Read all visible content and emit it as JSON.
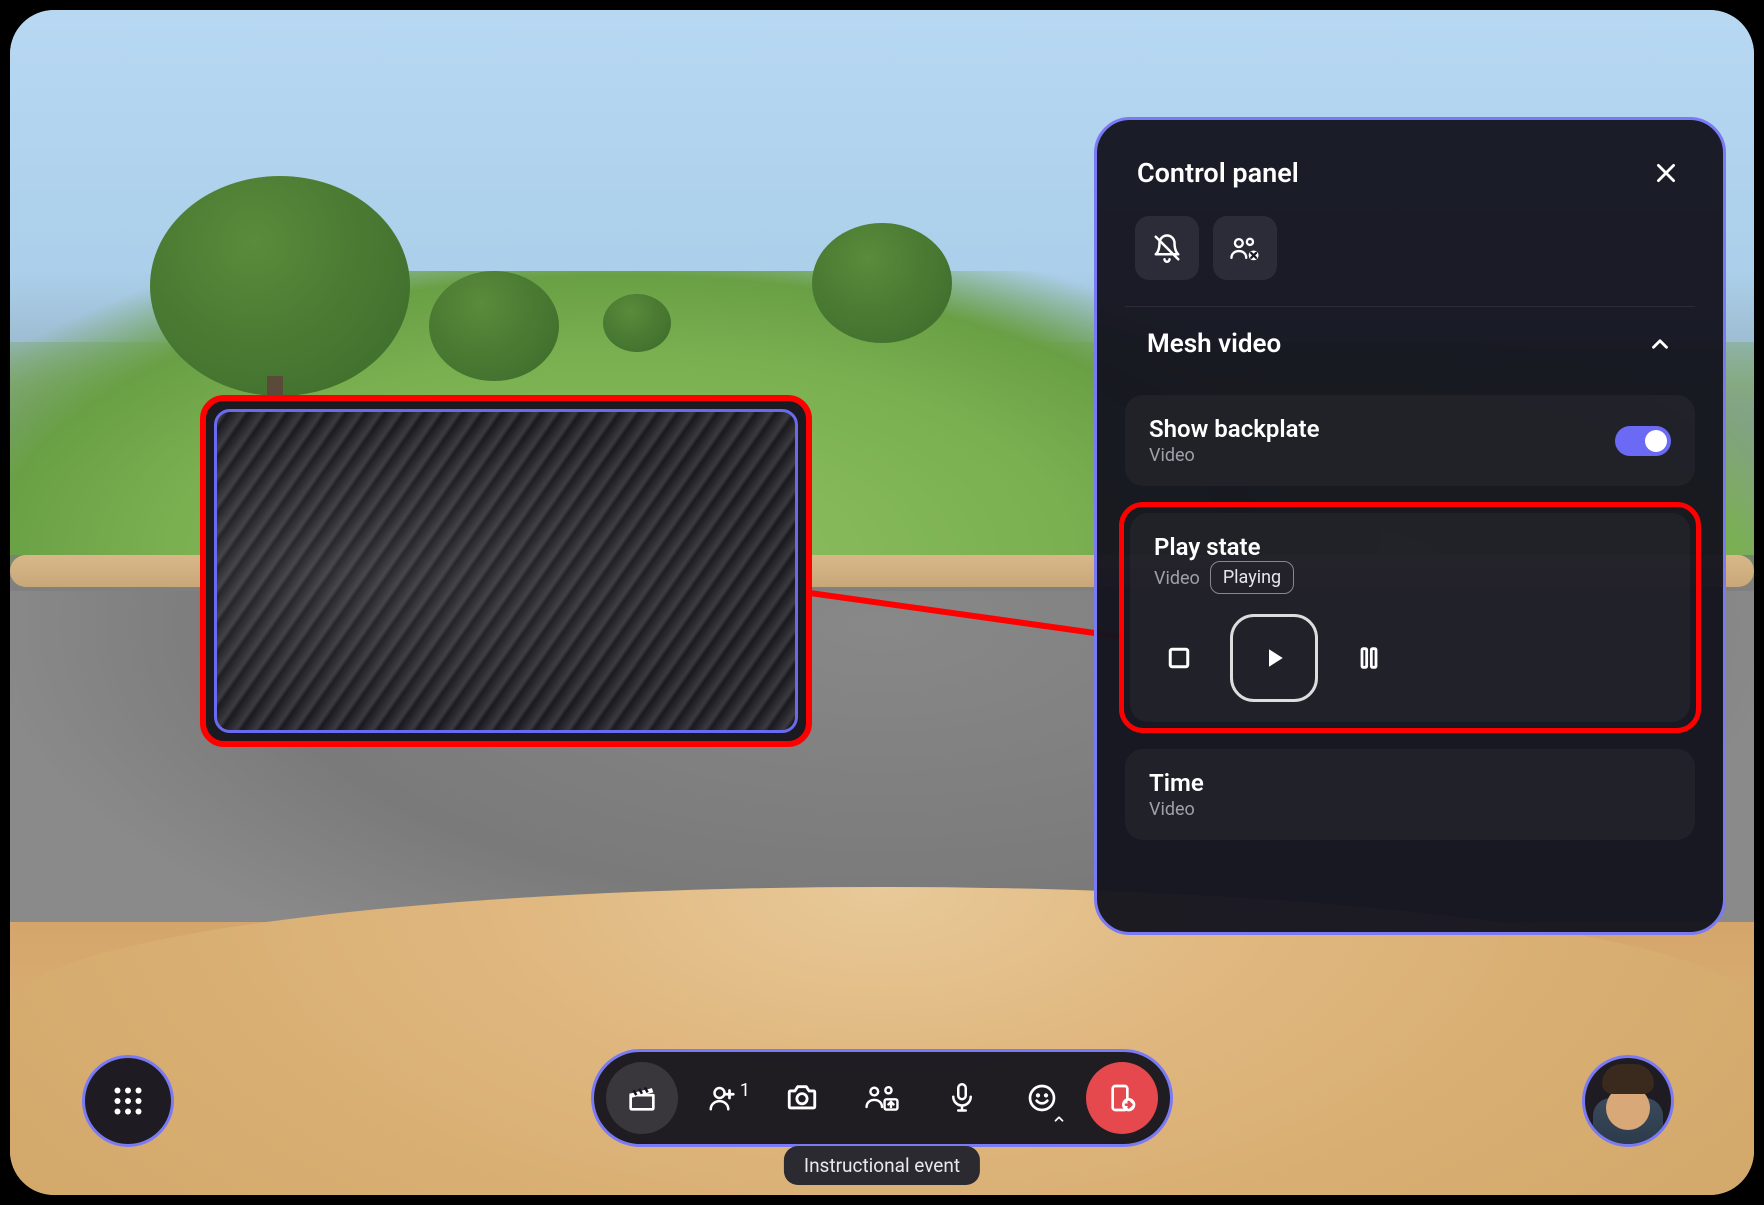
{
  "panel": {
    "title": "Control panel",
    "section_title": "Mesh video",
    "backplate": {
      "label": "Show backplate",
      "sub": "Video",
      "on": true
    },
    "playstate": {
      "label": "Play state",
      "sub": "Video",
      "status": "Playing"
    },
    "time": {
      "label": "Time",
      "sub": "Video"
    }
  },
  "dock": {
    "people_count": "1"
  },
  "caption": "Instructional event",
  "colors": {
    "accent": "#7a7af5",
    "highlight": "#ff0000",
    "danger": "#e5484d"
  }
}
